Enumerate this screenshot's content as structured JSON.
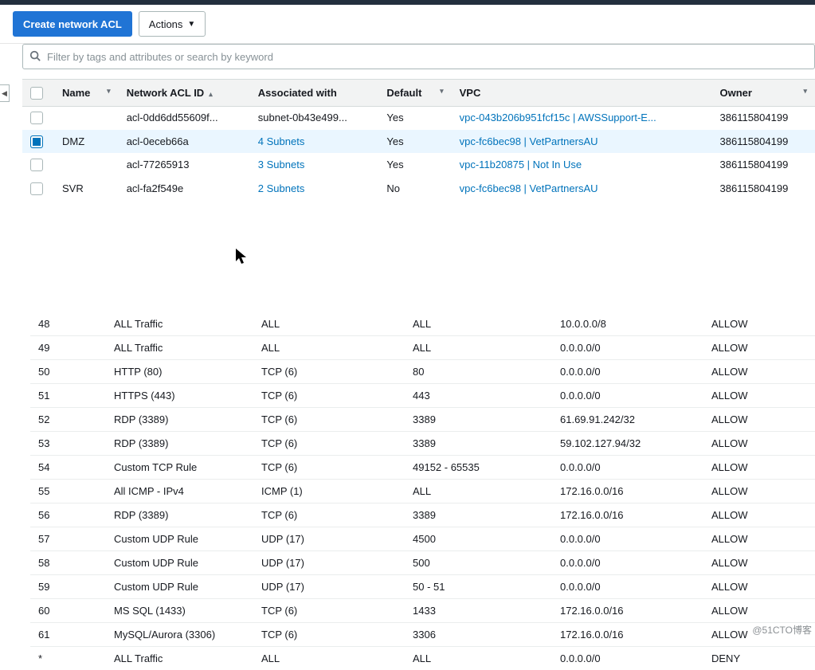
{
  "toolbar": {
    "create_label": "Create network ACL",
    "actions_label": "Actions"
  },
  "search": {
    "placeholder": "Filter by tags and attributes or search by keyword"
  },
  "acl_columns": {
    "name": "Name",
    "acl_id": "Network ACL ID",
    "assoc": "Associated with",
    "default": "Default",
    "vpc": "VPC",
    "owner": "Owner"
  },
  "acl_rows": [
    {
      "selected": false,
      "name": "",
      "acl_id": "acl-0dd6dd55609f...",
      "assoc": "subnet-0b43e499...",
      "assoc_link": false,
      "default": "Yes",
      "vpc": "vpc-043b206b951fcf15c | AWSSupport-E...",
      "owner": "386115804199"
    },
    {
      "selected": true,
      "name": "DMZ",
      "acl_id": "acl-0eceb66a",
      "assoc": "4 Subnets",
      "assoc_link": true,
      "default": "Yes",
      "vpc": "vpc-fc6bec98 | VetPartnersAU",
      "owner": "386115804199"
    },
    {
      "selected": false,
      "name": "",
      "acl_id": "acl-77265913",
      "assoc": "3 Subnets",
      "assoc_link": true,
      "default": "Yes",
      "vpc": "vpc-11b20875 | Not In Use",
      "owner": "386115804199"
    },
    {
      "selected": false,
      "name": "SVR",
      "acl_id": "acl-fa2f549e",
      "assoc": "2 Subnets",
      "assoc_link": true,
      "default": "No",
      "vpc": "vpc-fc6bec98 | VetPartnersAU",
      "owner": "386115804199"
    }
  ],
  "rules": [
    {
      "num": "48",
      "type": "ALL Traffic",
      "proto": "ALL",
      "port": "ALL",
      "src": "10.0.0.0/8",
      "act": "ALLOW"
    },
    {
      "num": "49",
      "type": "ALL Traffic",
      "proto": "ALL",
      "port": "ALL",
      "src": "0.0.0.0/0",
      "act": "ALLOW"
    },
    {
      "num": "50",
      "type": "HTTP (80)",
      "proto": "TCP (6)",
      "port": "80",
      "src": "0.0.0.0/0",
      "act": "ALLOW"
    },
    {
      "num": "51",
      "type": "HTTPS (443)",
      "proto": "TCP (6)",
      "port": "443",
      "src": "0.0.0.0/0",
      "act": "ALLOW"
    },
    {
      "num": "52",
      "type": "RDP (3389)",
      "proto": "TCP (6)",
      "port": "3389",
      "src": "61.69.91.242/32",
      "act": "ALLOW"
    },
    {
      "num": "53",
      "type": "RDP (3389)",
      "proto": "TCP (6)",
      "port": "3389",
      "src": "59.102.127.94/32",
      "act": "ALLOW"
    },
    {
      "num": "54",
      "type": "Custom TCP Rule",
      "proto": "TCP (6)",
      "port": "49152 - 65535",
      "src": "0.0.0.0/0",
      "act": "ALLOW"
    },
    {
      "num": "55",
      "type": "All ICMP - IPv4",
      "proto": "ICMP (1)",
      "port": "ALL",
      "src": "172.16.0.0/16",
      "act": "ALLOW"
    },
    {
      "num": "56",
      "type": "RDP (3389)",
      "proto": "TCP (6)",
      "port": "3389",
      "src": "172.16.0.0/16",
      "act": "ALLOW"
    },
    {
      "num": "57",
      "type": "Custom UDP Rule",
      "proto": "UDP (17)",
      "port": "4500",
      "src": "0.0.0.0/0",
      "act": "ALLOW"
    },
    {
      "num": "58",
      "type": "Custom UDP Rule",
      "proto": "UDP (17)",
      "port": "500",
      "src": "0.0.0.0/0",
      "act": "ALLOW"
    },
    {
      "num": "59",
      "type": "Custom UDP Rule",
      "proto": "UDP (17)",
      "port": "50 - 51",
      "src": "0.0.0.0/0",
      "act": "ALLOW"
    },
    {
      "num": "60",
      "type": "MS SQL (1433)",
      "proto": "TCP (6)",
      "port": "1433",
      "src": "172.16.0.0/16",
      "act": "ALLOW"
    },
    {
      "num": "61",
      "type": "MySQL/Aurora (3306)",
      "proto": "TCP (6)",
      "port": "3306",
      "src": "172.16.0.0/16",
      "act": "ALLOW"
    },
    {
      "num": "*",
      "type": "ALL Traffic",
      "proto": "ALL",
      "port": "ALL",
      "src": "0.0.0.0/0",
      "act": "DENY"
    }
  ],
  "watermark": "@51CTO博客"
}
